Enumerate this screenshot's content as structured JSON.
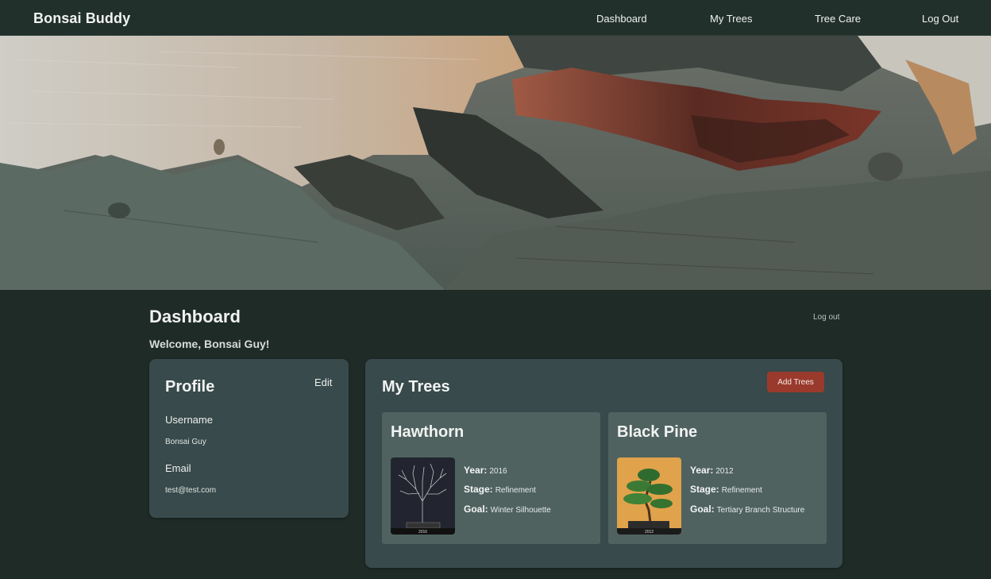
{
  "nav": {
    "brand": "Bonsai Buddy",
    "links": [
      "Dashboard",
      "My Trees",
      "Tree Care",
      "Log Out"
    ]
  },
  "hero": {
    "image": "bark-texture"
  },
  "page": {
    "title": "Dashboard",
    "welcome": "Welcome, Bonsai Guy!",
    "logout": "Log out"
  },
  "profile": {
    "title": "Profile",
    "edit": "Edit",
    "username_label": "Username",
    "username": "Bonsai Guy",
    "email_label": "Email",
    "email": "test@test.com"
  },
  "trees": {
    "title": "My Trees",
    "add_button": "Add Trees",
    "labels": {
      "year": "Year:",
      "stage": "Stage:",
      "goal": "Goal:"
    },
    "items": [
      {
        "name": "Hawthorn",
        "year": "2016",
        "stage": "Refinement",
        "goal": "Winter Silhouette",
        "photo_caption": "2016"
      },
      {
        "name": "Black Pine",
        "year": "2012",
        "stage": "Refinement",
        "goal": "Tertiary Branch Structure",
        "photo_caption": "2012"
      }
    ]
  },
  "colors": {
    "background": "#1f2b27",
    "card": "#384a4b",
    "tree_card": "#4f6260",
    "accent_button": "#9a3a2c"
  }
}
